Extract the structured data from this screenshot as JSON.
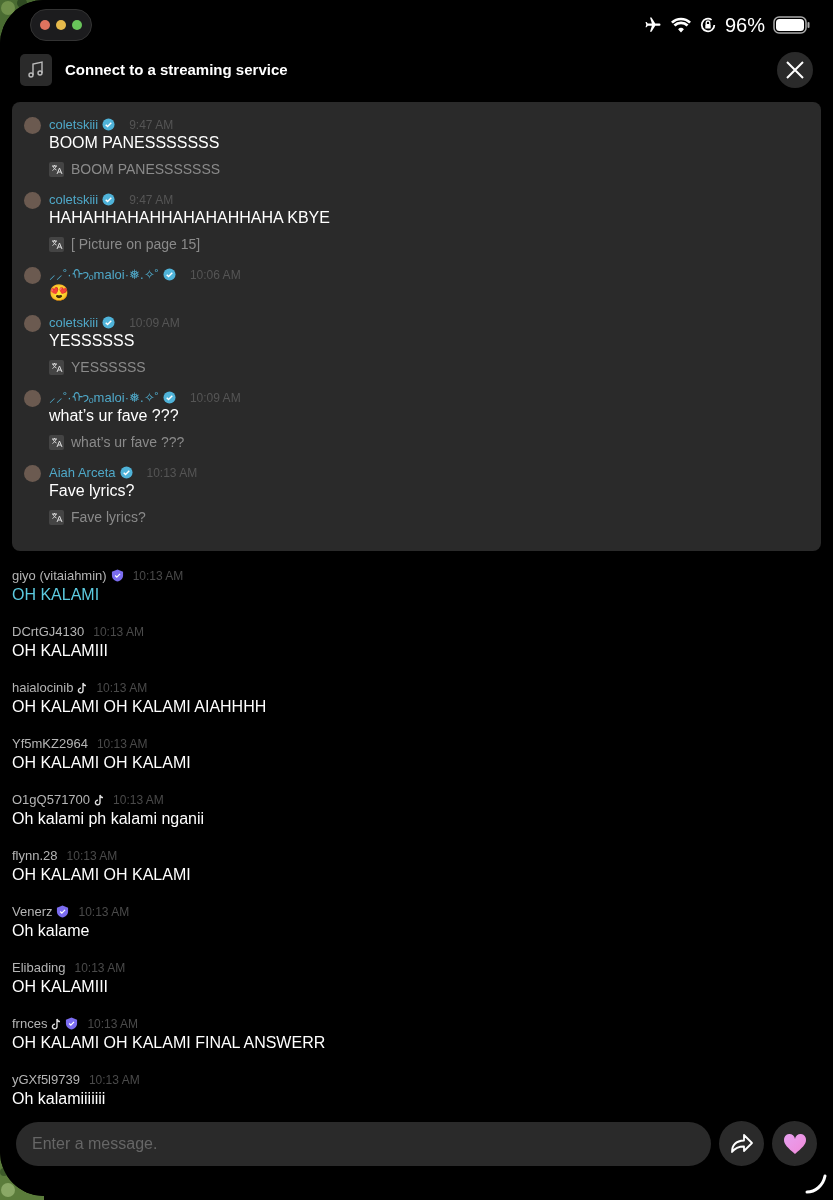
{
  "status_bar": {
    "battery": "96%"
  },
  "header": {
    "title": "Connect to a streaming service"
  },
  "pinned": [
    {
      "user": "coletskiii",
      "badges": [
        {
          "kind": "verified"
        }
      ],
      "time": "9:47 AM",
      "text": "BOOM PANESSSSSSS",
      "translation": "BOOM PANESSSSSSS"
    },
    {
      "user": "coletskiii",
      "badges": [
        {
          "kind": "verified"
        }
      ],
      "time": "9:47 AM",
      "text": "HAHAHHAHAHHAHAHAHHAHA KBYE",
      "translation": "[ Picture on page 15]"
    },
    {
      "user": "⸝⸝˚·ᡣ𐭩ₒmaloi·❅.✧˚",
      "badges": [
        {
          "kind": "verified"
        }
      ],
      "time": "10:06 AM",
      "text": "😍"
    },
    {
      "user": "coletskiii",
      "badges": [
        {
          "kind": "verified"
        }
      ],
      "time": "10:09 AM",
      "text": "YESSSSSS",
      "translation": "YESSSSSS"
    },
    {
      "user": "⸝⸝˚·ᡣ𐭩ₒmaloi·❅.✧˚",
      "badges": [
        {
          "kind": "verified"
        }
      ],
      "time": "10:09 AM",
      "text": "what’s ur fave ???",
      "translation": "what’s ur fave ???"
    },
    {
      "user": "Aiah Arceta",
      "badges": [
        {
          "kind": "verified"
        }
      ],
      "time": "10:13 AM",
      "text": "Fave lyrics?",
      "translation": "Fave lyrics?"
    }
  ],
  "chat": [
    {
      "user": "giyo (vitaiahmin)",
      "badges": [
        {
          "kind": "shield"
        }
      ],
      "time": "10:13 AM",
      "text": "OH KALAMI",
      "highlighted": true
    },
    {
      "user": "DCrtGJ4130",
      "time": "10:13 AM",
      "text": "OH KALAMIII",
      "highlighted": false
    },
    {
      "user": "haialocinib",
      "badges": [
        {
          "kind": "tiktok"
        }
      ],
      "time": "10:13 AM",
      "text": "OH KALAMI OH KALAMI AIAHHHH",
      "highlighted": false
    },
    {
      "user": "Yf5mKZ2964",
      "time": "10:13 AM",
      "text": "OH KALAMI OH KALAMI",
      "highlighted": false
    },
    {
      "user": "O1gQ571700",
      "badges": [
        {
          "kind": "tiktok"
        }
      ],
      "time": "10:13 AM",
      "text": "Oh kalami ph kalami nganii",
      "highlighted": false
    },
    {
      "user": "flynn.28",
      "time": "10:13 AM",
      "text": "OH KALAMI OH KALAMI",
      "highlighted": false
    },
    {
      "user": "Venerz",
      "badges": [
        {
          "kind": "shield"
        }
      ],
      "time": "10:13 AM",
      "text": "Oh kalame",
      "highlighted": false
    },
    {
      "user": "Elibading",
      "time": "10:13 AM",
      "text": "OH KALAMIII",
      "highlighted": false
    },
    {
      "user": "frnces",
      "badges": [
        {
          "kind": "tiktok"
        },
        {
          "kind": "shield"
        }
      ],
      "time": "10:13 AM",
      "text": "OH KALAMI OH KALAMI FINAL ANSWERR",
      "highlighted": false
    },
    {
      "user": "yGXf5l9739",
      "time": "10:13 AM",
      "text": "Oh kalamiiiiiii",
      "highlighted": false
    }
  ],
  "composer": {
    "placeholder": "Enter a message."
  }
}
